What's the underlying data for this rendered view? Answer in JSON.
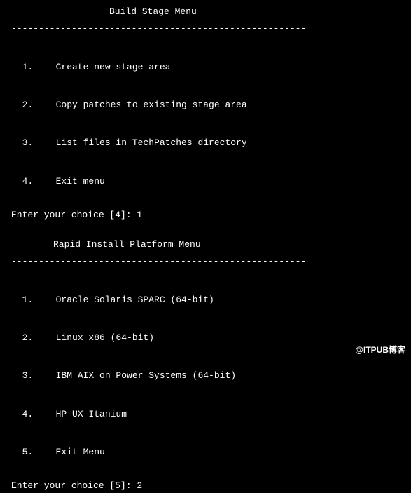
{
  "menu1": {
    "title": "Build Stage Menu",
    "divider": "------------------------------------------------------",
    "items": [
      {
        "num": "1.",
        "label": "Create new stage area"
      },
      {
        "num": "2.",
        "label": "Copy patches to existing stage area"
      },
      {
        "num": "3.",
        "label": "List files in TechPatches directory"
      },
      {
        "num": "4.",
        "label": "Exit menu"
      }
    ],
    "prompt": "Enter your choice [4]: 1"
  },
  "menu2": {
    "title": "Rapid Install Platform Menu",
    "divider": "------------------------------------------------------",
    "items": [
      {
        "num": "1.",
        "label": "Oracle Solaris SPARC (64-bit)"
      },
      {
        "num": "2.",
        "label": "Linux x86 (64-bit)"
      },
      {
        "num": "3.",
        "label": "IBM AIX on Power Systems (64-bit)"
      },
      {
        "num": "4.",
        "label": "HP-UX Itanium"
      },
      {
        "num": "5.",
        "label": "Exit Menu"
      }
    ],
    "prompt": "Enter your choice [5]: 2"
  },
  "watermark": "@ITPUB博客"
}
